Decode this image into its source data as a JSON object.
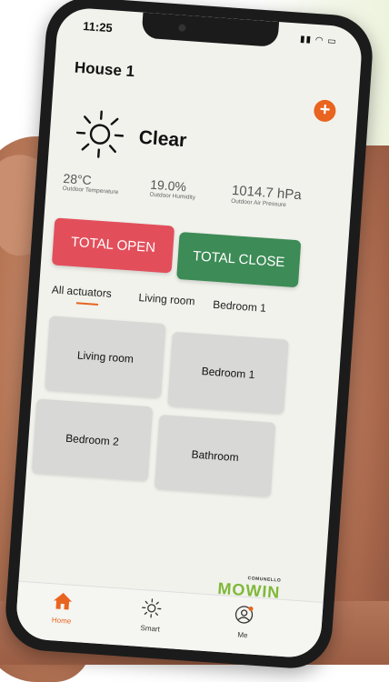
{
  "status": {
    "time": "11:25"
  },
  "house": {
    "title": "House 1"
  },
  "weather": {
    "condition": "Clear",
    "temperature": "28°C",
    "temperature_label": "Outdoor Temperature",
    "humidity": "19.0%",
    "humidity_label": "Outdoor Humidity",
    "pressure": "1014.7 hPa",
    "pressure_label": "Outdoor Air Pressure"
  },
  "actions": {
    "total_open": "TOTAL OPEN",
    "total_close": "TOTAL CLOSE"
  },
  "tabs": [
    {
      "label": "All actuators",
      "active": true
    },
    {
      "label": "Living room"
    },
    {
      "label": "Bedroom 1"
    }
  ],
  "rooms": [
    {
      "label": "Living room"
    },
    {
      "label": "Bedroom 1"
    },
    {
      "label": "Bedroom 2"
    },
    {
      "label": "Bathroom"
    }
  ],
  "brand": {
    "maker": "COMUNELLO",
    "name": "MOWIN"
  },
  "nav": [
    {
      "label": "Home",
      "icon": "home-icon",
      "active": true
    },
    {
      "label": "Smart",
      "icon": "sun-icon"
    },
    {
      "label": "Me",
      "icon": "profile-icon"
    }
  ],
  "colors": {
    "accent": "#e8641f",
    "open": "#e24f5b",
    "close": "#3d8b56",
    "brand": "#7fb83a"
  }
}
